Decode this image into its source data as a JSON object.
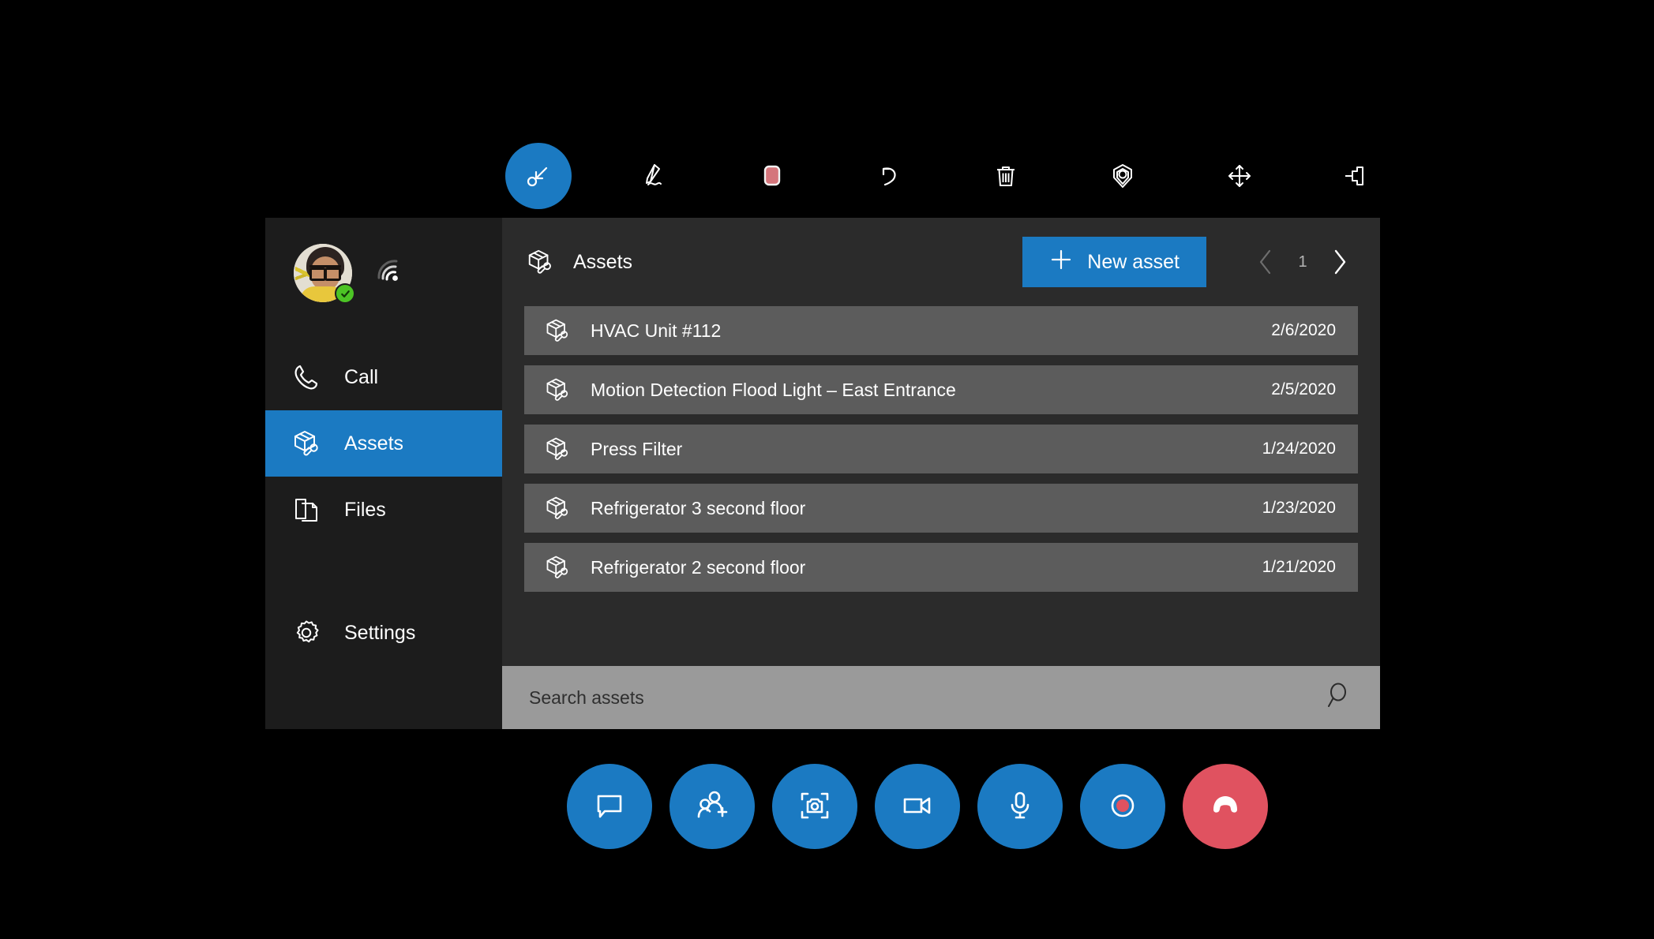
{
  "toolbar": {
    "tools": [
      {
        "name": "select-tool",
        "icon": "cursor-select-icon",
        "label": "Select",
        "active": true
      },
      {
        "name": "ink-tool",
        "icon": "pen-icon",
        "label": "Ink",
        "active": false
      },
      {
        "name": "color-swatch",
        "icon": "color-swatch-icon",
        "label": "Color",
        "active": false,
        "color": "#d4757b"
      },
      {
        "name": "undo-tool",
        "icon": "undo-icon",
        "label": "Undo",
        "active": false
      },
      {
        "name": "delete-tool",
        "icon": "trash-icon",
        "label": "Delete",
        "active": false
      },
      {
        "name": "anchor-tool",
        "icon": "location-pin-icon",
        "label": "Place anchor",
        "active": false
      },
      {
        "name": "move-tool",
        "icon": "move-arrows-icon",
        "label": "Move",
        "active": false
      },
      {
        "name": "pin-tool",
        "icon": "pushpin-icon",
        "label": "Pin",
        "active": false
      }
    ]
  },
  "sidebar": {
    "profile": {
      "status_icon": "check-badge-icon",
      "signal_icon": "signal-strength-icon"
    },
    "items": [
      {
        "label": "Call",
        "icon": "phone-icon",
        "selected": false
      },
      {
        "label": "Assets",
        "icon": "asset-box-icon",
        "selected": true
      },
      {
        "label": "Files",
        "icon": "files-icon",
        "selected": false
      },
      {
        "label": "Settings",
        "icon": "gear-icon",
        "selected": false
      }
    ]
  },
  "header": {
    "icon": "asset-box-icon",
    "title": "Assets",
    "new_asset_label": "New asset",
    "new_asset_icon": "plus-icon",
    "pager": {
      "prev_icon": "chevron-left-icon",
      "next_icon": "chevron-right-icon",
      "page": "1",
      "prev_enabled": false,
      "next_enabled": true
    }
  },
  "assets": {
    "rows": [
      {
        "icon": "asset-box-icon",
        "name": "HVAC Unit #112",
        "date": "2/6/2020"
      },
      {
        "icon": "asset-box-icon",
        "name": "Motion Detection Flood Light – East Entrance",
        "date": "2/5/2020"
      },
      {
        "icon": "asset-box-icon",
        "name": "Press Filter",
        "date": "1/24/2020"
      },
      {
        "icon": "asset-box-icon",
        "name": "Refrigerator 3 second floor",
        "date": "1/23/2020"
      },
      {
        "icon": "asset-box-icon",
        "name": "Refrigerator 2 second floor",
        "date": "1/21/2020"
      }
    ]
  },
  "search": {
    "placeholder": "Search assets",
    "value": "",
    "icon": "search-icon"
  },
  "call_controls": {
    "buttons": [
      {
        "name": "chat-button",
        "icon": "chat-bubble-icon",
        "label": "Chat",
        "variant": "primary"
      },
      {
        "name": "add-person-button",
        "icon": "add-person-icon",
        "label": "Add people",
        "variant": "primary"
      },
      {
        "name": "capture-button",
        "icon": "camera-frame-icon",
        "label": "Capture",
        "variant": "primary"
      },
      {
        "name": "video-button",
        "icon": "video-camera-icon",
        "label": "Video",
        "variant": "primary"
      },
      {
        "name": "mute-button",
        "icon": "microphone-icon",
        "label": "Microphone",
        "variant": "primary"
      },
      {
        "name": "record-button",
        "icon": "record-dot-icon",
        "label": "Record",
        "variant": "primary"
      },
      {
        "name": "end-call-button",
        "icon": "hang-up-icon",
        "label": "End call",
        "variant": "end"
      }
    ]
  },
  "colors": {
    "accent": "#1b7ac2",
    "end_call": "#e05260",
    "panel": "#2b2b2b",
    "sidebar": "#1c1c1c",
    "row": "#5c5c5c",
    "search_bar": "#9a9a9a",
    "status_online": "#4cc425",
    "swatch": "#d4757b"
  }
}
